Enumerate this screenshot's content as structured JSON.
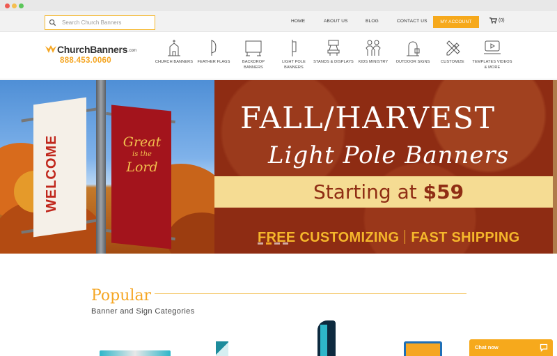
{
  "search": {
    "placeholder": "Search Church Banners"
  },
  "top_links": {
    "home": "HOME",
    "about": "ABOUT US",
    "blog": "BLOG",
    "contact": "CONTACT US",
    "account": "MY ACCOUNT",
    "cart_count": "(0)"
  },
  "logo": {
    "brand": "ChurchBanners",
    "suffix": ".com",
    "phone": "888.453.0060"
  },
  "nav": [
    {
      "label": "CHURCH BANNERS",
      "icon": "church-icon"
    },
    {
      "label": "FEATHER FLAGS",
      "icon": "feather-flag-icon"
    },
    {
      "label": "BACKDROP BANNERS",
      "icon": "backdrop-icon"
    },
    {
      "label": "LIGHT POLE BANNERS",
      "icon": "light-pole-icon"
    },
    {
      "label": "STANDS & DISPLAYS",
      "icon": "stand-icon"
    },
    {
      "label": "KIDS MINISTRY",
      "icon": "kids-icon"
    },
    {
      "label": "OUTDOOR SIGNS",
      "icon": "outdoor-sign-icon"
    },
    {
      "label": "CUSTOMIZE",
      "icon": "pencil-ruler-icon"
    },
    {
      "label": "TEMPLATES VIDEOS & MORE",
      "icon": "video-icon"
    }
  ],
  "hero": {
    "title": "FALL/HARVEST",
    "script": "Light Pole Banners",
    "price_prefix": "Starting at",
    "price": "$59",
    "free": "FREE CUSTOMIZING",
    "fast": "FAST SHIPPING",
    "welcome_banner": "WELCOME",
    "great_banner_1": "Great",
    "great_banner_2": "is the",
    "great_banner_3": "Lord"
  },
  "popular": {
    "title": "Popular",
    "subtitle": "Banner and Sign Categories"
  },
  "chat": {
    "label": "Chat now"
  },
  "colors": {
    "accent": "#f6a91c",
    "hero_bg": "#8f2d14",
    "band": "#f5dc93"
  }
}
